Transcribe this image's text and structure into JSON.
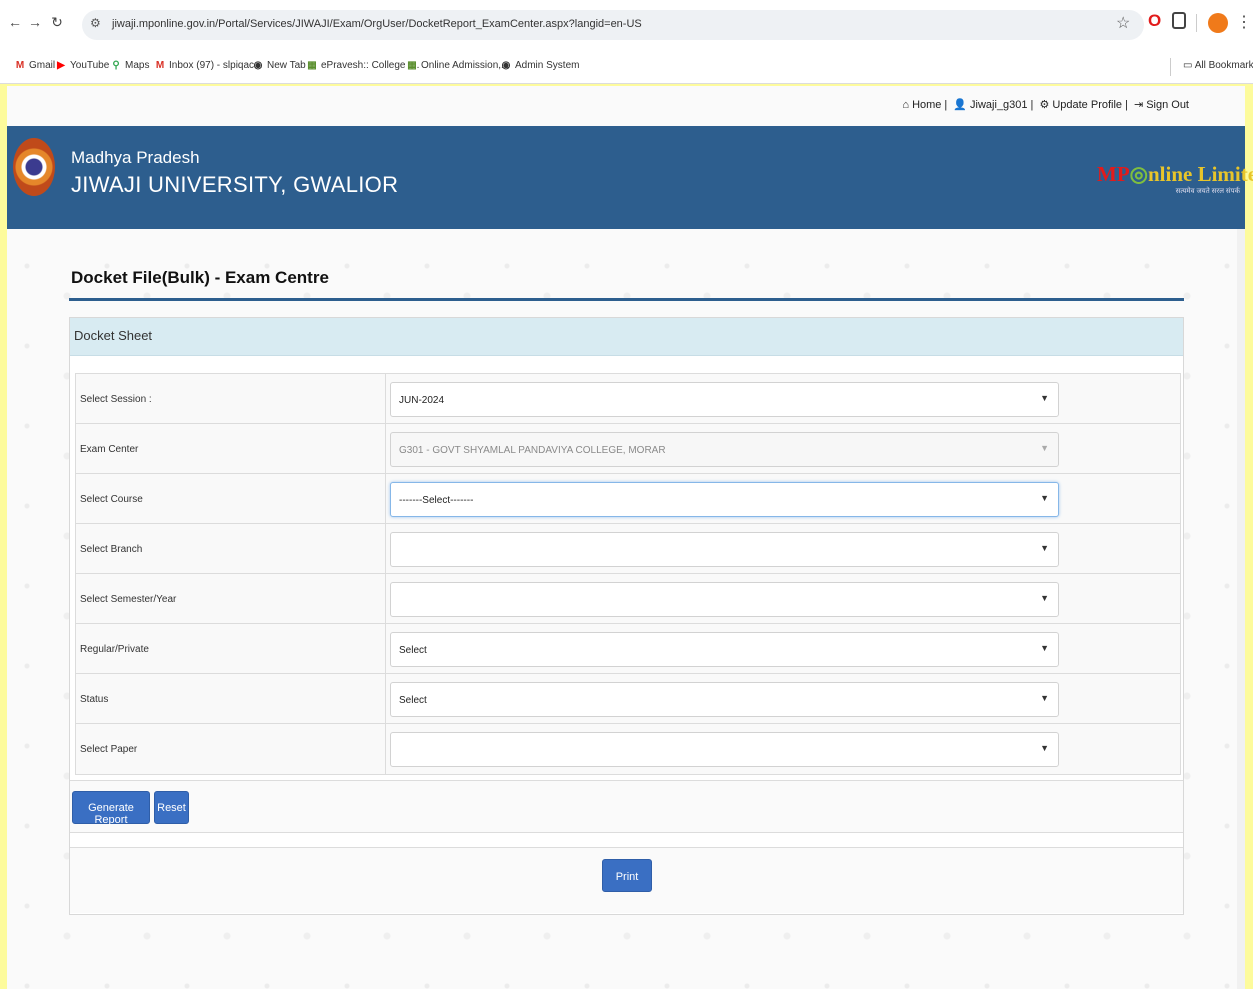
{
  "browser": {
    "url": "jiwaji.mponline.gov.in/Portal/Services/JIWAJI/Exam/OrgUser/DocketReport_ExamCenter.aspx?langid=en-US",
    "bookmarks": [
      {
        "label": "Gmail",
        "icon": "gmail-icon",
        "glyph": "M",
        "color": "#d93025"
      },
      {
        "label": "YouTube",
        "icon": "youtube-icon",
        "glyph": "▶",
        "color": "#ff0000"
      },
      {
        "label": "Maps",
        "icon": "maps-icon",
        "glyph": "⚲",
        "color": "#34a853"
      },
      {
        "label": "Inbox (97) - slpiqac...",
        "icon": "gmail-icon",
        "glyph": "M",
        "color": "#d93025"
      },
      {
        "label": "New Tab",
        "icon": "globe-icon",
        "glyph": "◉",
        "color": "#333333"
      },
      {
        "label": "ePravesh:: College :...",
        "icon": "site-icon",
        "glyph": "▦",
        "color": "#5a8f2e"
      },
      {
        "label": "Online Admission,...",
        "icon": "site-icon",
        "glyph": "▦",
        "color": "#5a8f2e"
      },
      {
        "label": "Admin System",
        "icon": "globe-icon",
        "glyph": "◉",
        "color": "#333333"
      }
    ],
    "all_bookmarks": "All Bookmarks"
  },
  "userbar": {
    "home": "Home",
    "user": "Jiwaji_g301",
    "update_profile": "Update Profile",
    "sign_out": "Sign Out"
  },
  "banner": {
    "state": "Madhya Pradesh",
    "university": "JIWAJI UNIVERSITY, GWALIOR",
    "logo_prefix": "MP",
    "logo_suffix": "nline Limited",
    "logo_sub": "सत्यमेव जयते सरल संपर्क"
  },
  "page": {
    "title": "Docket File(Bulk) - Exam Centre",
    "panel_title": "Docket Sheet"
  },
  "form": {
    "rows": [
      {
        "label": "Select Session :",
        "value": "JUN-2024"
      },
      {
        "label": "Exam Center",
        "value": "G301 - GOVT SHYAMLAL PANDAVIYA COLLEGE, MORAR"
      },
      {
        "label": "Select Course",
        "value": "-------Select-------"
      },
      {
        "label": "Select Branch",
        "value": ""
      },
      {
        "label": "Select Semester/Year",
        "value": ""
      },
      {
        "label": "Regular/Private",
        "value": "Select"
      },
      {
        "label": "Status",
        "value": "Select"
      },
      {
        "label": "Select Paper",
        "value": ""
      }
    ]
  },
  "buttons": {
    "generate": "Generate Report",
    "reset": "Reset",
    "print": "Print"
  },
  "colors": {
    "banner": "#2d5e8e",
    "panel_header": "#d8ebf2",
    "button": "#3a6fc3"
  }
}
